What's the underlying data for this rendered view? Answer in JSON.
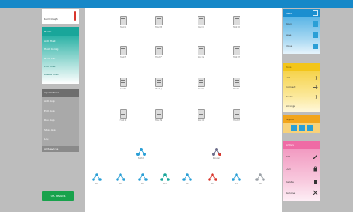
{
  "left_panel": {
    "header_label": "Build Graph",
    "teal_section": {
      "title": "Hosts",
      "items": [
        "Add Host",
        "Host Config",
        "Host Info",
        "Edit Host",
        "Delete Host"
      ]
    },
    "gray_section": {
      "title": "Applications",
      "items": [
        "Add App",
        "Edit App",
        "Run App",
        "Stop App",
        "Log"
      ],
      "footer": "All Services"
    },
    "ok_button": "OK Results"
  },
  "canvas": {
    "device_rows": [
      [
        "Host A",
        "Host B",
        "Host C",
        "Host D"
      ],
      [
        "Host E",
        "Host F",
        "Host G",
        "Host H"
      ],
      [
        "Host I",
        "Host J",
        "Host K",
        "Host L"
      ],
      [
        "Host M",
        "Host N",
        "Host O",
        "Host P"
      ]
    ],
    "mid_nodes": [
      "Switch",
      "Router"
    ],
    "bottom_nodes": [
      "N1",
      "N2",
      "N3",
      "N4",
      "N5",
      "N6",
      "N7",
      "N8"
    ],
    "node_colors": [
      "#2a9fd6",
      "#2a9fd6",
      "#2a9fd6",
      "#19a69a",
      "#2a9fd6",
      "#d9362c",
      "#2a9fd6",
      "#9aa0a6"
    ]
  },
  "right_panel": {
    "blue_title": "Menu",
    "blue_items": [
      "Open",
      "Save",
      "Close"
    ],
    "yellow_title": "Tools",
    "yellow_items": [
      "Link",
      "Connect",
      "Route",
      "Arrange"
    ],
    "orange_title": "Layout",
    "pink_title": "Actions",
    "pink_items": [
      "Edit",
      "Lock",
      "Delete",
      "Remove"
    ]
  },
  "colors": {
    "topbar": "#1688c8",
    "teal": "#19a69a",
    "green": "#18a24c",
    "yellow": "#f3c519",
    "pink": "#ef6ba5"
  }
}
